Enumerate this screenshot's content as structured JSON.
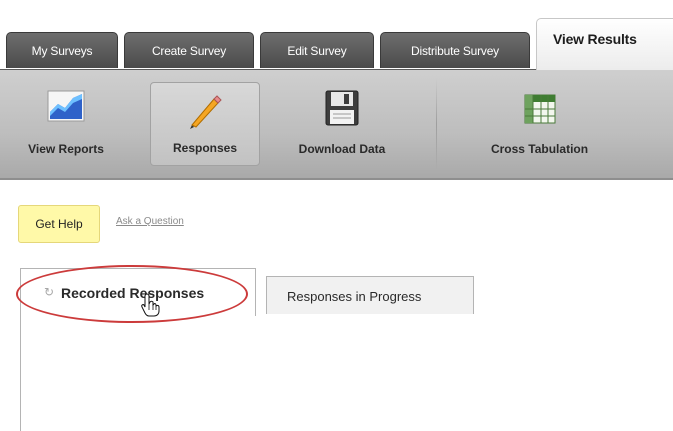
{
  "tabs": [
    {
      "label": "My Surveys"
    },
    {
      "label": "Create Survey"
    },
    {
      "label": "Edit Survey"
    },
    {
      "label": "Distribute Survey"
    },
    {
      "label": "View Results",
      "active": true
    }
  ],
  "toolbar": [
    {
      "label": "View Reports",
      "icon": "chart-icon"
    },
    {
      "label": "Responses",
      "icon": "pencil-icon",
      "active": true
    },
    {
      "label": "Download Data",
      "icon": "floppy-disk-icon"
    },
    {
      "label": "Cross Tabulation",
      "icon": "table-icon"
    }
  ],
  "help": {
    "button_label": "Get Help",
    "link_label": "Ask a Question"
  },
  "subtabs": [
    {
      "label": "Recorded Responses",
      "active": true,
      "icon": "spinner-icon"
    },
    {
      "label": "Responses in Progress"
    }
  ],
  "colors": {
    "highlight_ellipse": "#cc3b3b",
    "help_button": "#fff9a8",
    "tab_dark": "#4a4a4a"
  }
}
